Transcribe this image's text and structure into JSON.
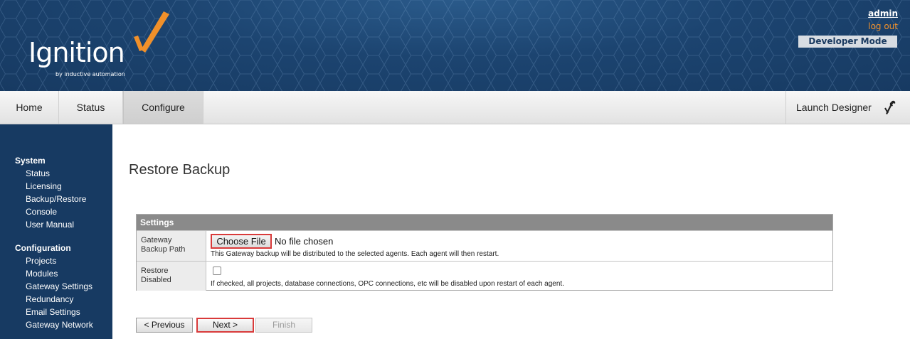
{
  "header": {
    "logo_text": "Ignition",
    "logo_subtext": "by inductive automation",
    "user": "admin",
    "logout": "log out",
    "mode_badge": "Developer Mode"
  },
  "nav": {
    "tabs": [
      {
        "label": "Home"
      },
      {
        "label": "Status"
      },
      {
        "label": "Configure",
        "active": true
      }
    ],
    "launch_designer": "Launch Designer",
    "launch_icon": "wrench-screwdriver-icon"
  },
  "sidebar": {
    "sections": [
      {
        "heading": "System",
        "items": [
          "Status",
          "Licensing",
          "Backup/Restore",
          "Console",
          "User Manual"
        ]
      },
      {
        "heading": "Configuration",
        "items": [
          "Projects",
          "Modules",
          "Gateway Settings",
          "Redundancy",
          "Email Settings",
          "Gateway Network"
        ]
      }
    ]
  },
  "main": {
    "title": "Restore Backup",
    "settings": {
      "heading": "Settings",
      "rows": [
        {
          "label_line1": "Gateway",
          "label_line2": "Backup Path",
          "button": "Choose File",
          "value": "No file chosen",
          "help": "This Gateway backup will be distributed to the selected agents. Each agent will then restart."
        },
        {
          "label_line1": "Restore",
          "label_line2": "Disabled",
          "checked": false,
          "help": "If checked, all projects, database connections, OPC connections, etc will be disabled upon restart of each agent."
        }
      ]
    },
    "buttons": {
      "previous": "< Previous",
      "next": "Next >",
      "finish": "Finish"
    }
  },
  "colors": {
    "header_blue": "#1c4470",
    "sidebar_blue": "#173a62",
    "accent_orange": "#f0902a",
    "highlight_red": "#d93a3a"
  }
}
